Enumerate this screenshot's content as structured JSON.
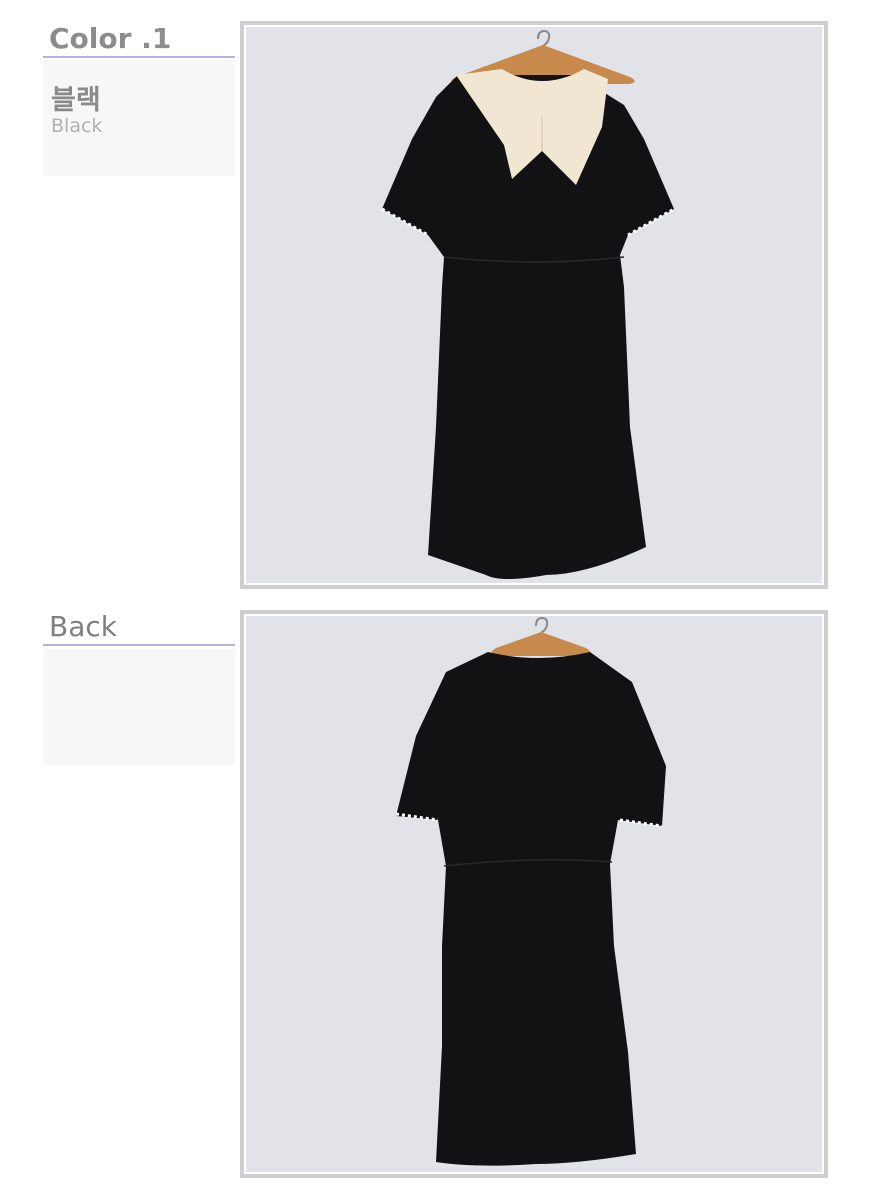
{
  "color_section": {
    "title": "Color .1",
    "korean_name": "블랙",
    "english_name": "Black"
  },
  "back_section": {
    "title": "Back"
  },
  "colors": {
    "accent_underline": "#b9b3d9",
    "dress": "#121214",
    "collar": "#f1e6d1",
    "backdrop": "#e2e3e8"
  }
}
